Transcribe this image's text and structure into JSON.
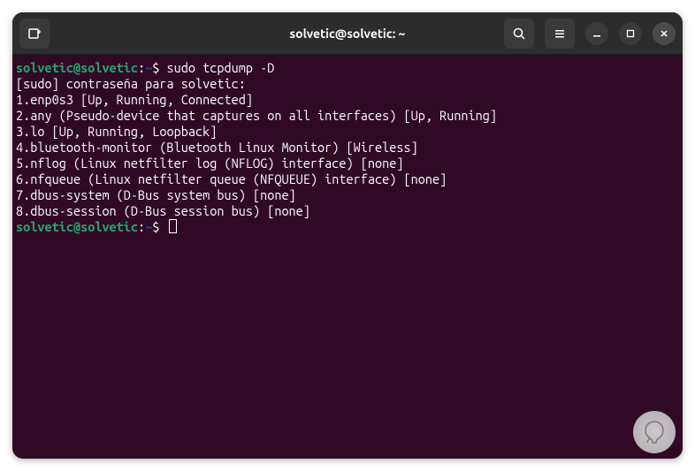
{
  "titlebar": {
    "title": "solvetic@solvetic: ~"
  },
  "prompt": {
    "user_host": "solvetic@solvetic",
    "separator": ":",
    "path": "~",
    "symbol": "$ "
  },
  "command1": "sudo tcpdump -D",
  "output": [
    "[sudo] contraseña para solvetic:",
    "1.enp0s3 [Up, Running, Connected]",
    "2.any (Pseudo-device that captures on all interfaces) [Up, Running]",
    "3.lo [Up, Running, Loopback]",
    "4.bluetooth-monitor (Bluetooth Linux Monitor) [Wireless]",
    "5.nflog (Linux netfilter log (NFLOG) interface) [none]",
    "6.nfqueue (Linux netfilter queue (NFQUEUE) interface) [none]",
    "7.dbus-system (D-Bus system bus) [none]",
    "8.dbus-session (D-Bus session bus) [none]"
  ]
}
